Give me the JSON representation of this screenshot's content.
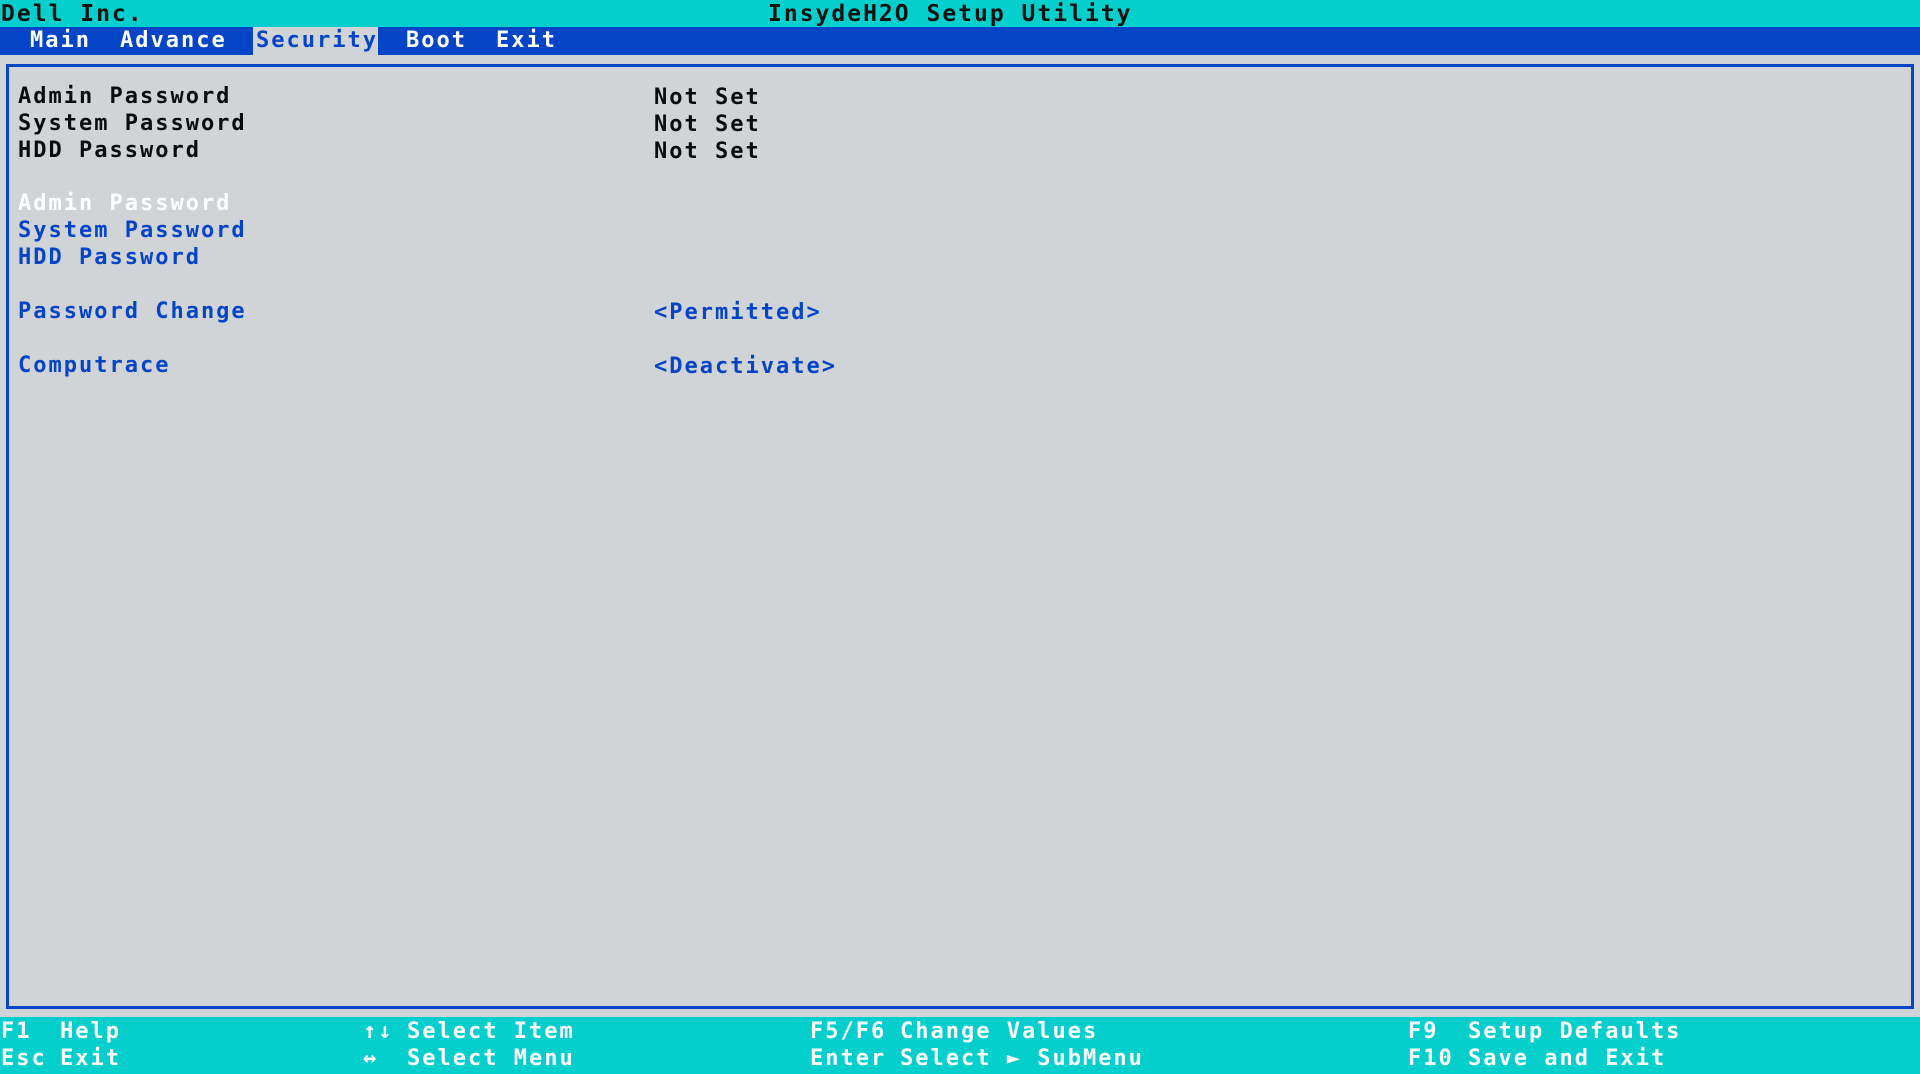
{
  "title_bar": {
    "vendor": "Dell Inc.",
    "title": "InsydeH2O Setup Utility"
  },
  "menu": {
    "tabs": [
      {
        "label": "Main"
      },
      {
        "label": "Advance"
      },
      {
        "label": "Security",
        "active": true
      },
      {
        "label": "Boot"
      },
      {
        "label": "Exit"
      }
    ]
  },
  "status": [
    {
      "label": "Admin Password",
      "value": "Not Set"
    },
    {
      "label": "System Password",
      "value": "Not Set"
    },
    {
      "label": "HDD Password",
      "value": "Not Set"
    }
  ],
  "items": [
    {
      "label": "Admin Password",
      "selected": true
    },
    {
      "label": "System Password"
    },
    {
      "label": "HDD Password"
    }
  ],
  "options": [
    {
      "label": "Password Change",
      "value": "<Permitted>"
    },
    {
      "label": "Computrace",
      "value": "<Deactivate>"
    }
  ],
  "help": {
    "f1_key": "F1",
    "f1_desc": "Help",
    "esc_key": "Esc",
    "esc_desc": "Exit",
    "updown_key": "↑↓",
    "updown_desc": "Select Item",
    "leftright_key": "↔",
    "leftright_desc": "Select Menu",
    "f5f6_key": "F5/F6",
    "f5f6_desc": "Change Values",
    "enter_key": "Enter",
    "enter_desc": "Select ► SubMenu",
    "f9_key": "F9",
    "f9_desc": "Setup Defaults",
    "f10_key": "F10",
    "f10_desc": "Save and Exit"
  },
  "colors": {
    "cyan_bar": "#05cfcd",
    "blue_accent": "#0444c6",
    "panel_gray": "#d0d4d7",
    "selected_text": "#ffffff"
  }
}
